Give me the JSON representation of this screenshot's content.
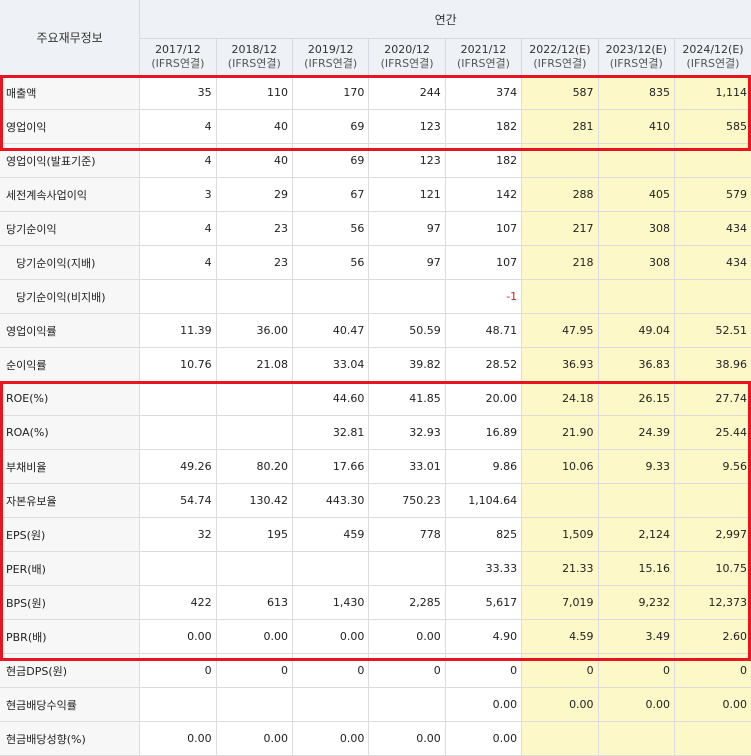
{
  "table": {
    "row_header": "주요재무정보",
    "group_header": "연간",
    "columns": [
      {
        "year": "2017/12",
        "basis": "(IFRS연결)",
        "estimate": false
      },
      {
        "year": "2018/12",
        "basis": "(IFRS연결)",
        "estimate": false
      },
      {
        "year": "2019/12",
        "basis": "(IFRS연결)",
        "estimate": false
      },
      {
        "year": "2020/12",
        "basis": "(IFRS연결)",
        "estimate": false
      },
      {
        "year": "2021/12",
        "basis": "(IFRS연결)",
        "estimate": false
      },
      {
        "year": "2022/12(E)",
        "basis": "(IFRS연결)",
        "estimate": true
      },
      {
        "year": "2023/12(E)",
        "basis": "(IFRS연결)",
        "estimate": true
      },
      {
        "year": "2024/12(E)",
        "basis": "(IFRS연결)",
        "estimate": true
      }
    ],
    "rows": [
      {
        "label": "매출액",
        "indent": false,
        "values": [
          "35",
          "110",
          "170",
          "244",
          "374",
          "587",
          "835",
          "1,114"
        ]
      },
      {
        "label": "영업이익",
        "indent": false,
        "values": [
          "4",
          "40",
          "69",
          "123",
          "182",
          "281",
          "410",
          "585"
        ]
      },
      {
        "label": "영업이익(발표기준)",
        "indent": false,
        "values": [
          "4",
          "40",
          "69",
          "123",
          "182",
          "",
          "",
          ""
        ]
      },
      {
        "label": "세전계속사업이익",
        "indent": false,
        "values": [
          "3",
          "29",
          "67",
          "121",
          "142",
          "288",
          "405",
          "579"
        ]
      },
      {
        "label": "당기순이익",
        "indent": false,
        "values": [
          "4",
          "23",
          "56",
          "97",
          "107",
          "217",
          "308",
          "434"
        ]
      },
      {
        "label": "당기순이익(지배)",
        "indent": true,
        "values": [
          "4",
          "23",
          "56",
          "97",
          "107",
          "218",
          "308",
          "434"
        ]
      },
      {
        "label": "당기순이익(비지배)",
        "indent": true,
        "values": [
          "",
          "",
          "",
          "",
          "-1",
          "",
          "",
          ""
        ]
      },
      {
        "label": "영업이익률",
        "indent": false,
        "values": [
          "11.39",
          "36.00",
          "40.47",
          "50.59",
          "48.71",
          "47.95",
          "49.04",
          "52.51"
        ]
      },
      {
        "label": "순이익률",
        "indent": false,
        "values": [
          "10.76",
          "21.08",
          "33.04",
          "39.82",
          "28.52",
          "36.93",
          "36.83",
          "38.96"
        ]
      },
      {
        "label": "ROE(%)",
        "indent": false,
        "values": [
          "",
          "",
          "44.60",
          "41.85",
          "20.00",
          "24.18",
          "26.15",
          "27.74"
        ]
      },
      {
        "label": "ROA(%)",
        "indent": false,
        "values": [
          "",
          "",
          "32.81",
          "32.93",
          "16.89",
          "21.90",
          "24.39",
          "25.44"
        ]
      },
      {
        "label": "부채비율",
        "indent": false,
        "values": [
          "49.26",
          "80.20",
          "17.66",
          "33.01",
          "9.86",
          "10.06",
          "9.33",
          "9.56"
        ]
      },
      {
        "label": "자본유보율",
        "indent": false,
        "values": [
          "54.74",
          "130.42",
          "443.30",
          "750.23",
          "1,104.64",
          "",
          "",
          ""
        ]
      },
      {
        "label": "EPS(원)",
        "indent": false,
        "values": [
          "32",
          "195",
          "459",
          "778",
          "825",
          "1,509",
          "2,124",
          "2,997"
        ]
      },
      {
        "label": "PER(배)",
        "indent": false,
        "values": [
          "",
          "",
          "",
          "",
          "33.33",
          "21.33",
          "15.16",
          "10.75"
        ]
      },
      {
        "label": "BPS(원)",
        "indent": false,
        "values": [
          "422",
          "613",
          "1,430",
          "2,285",
          "5,617",
          "7,019",
          "9,232",
          "12,373"
        ]
      },
      {
        "label": "PBR(배)",
        "indent": false,
        "values": [
          "0.00",
          "0.00",
          "0.00",
          "0.00",
          "4.90",
          "4.59",
          "3.49",
          "2.60"
        ]
      },
      {
        "label": "현금DPS(원)",
        "indent": false,
        "values": [
          "0",
          "0",
          "0",
          "0",
          "0",
          "0",
          "0",
          "0"
        ]
      },
      {
        "label": "현금배당수익률",
        "indent": false,
        "values": [
          "",
          "",
          "",
          "",
          "0.00",
          "0.00",
          "0.00",
          "0.00"
        ]
      },
      {
        "label": "현금배당성향(%)",
        "indent": false,
        "values": [
          "0.00",
          "0.00",
          "0.00",
          "0.00",
          "0.00",
          "",
          "",
          ""
        ]
      }
    ]
  },
  "colors": {
    "header_bg": "#eef2f6",
    "estimate_bg": "#fdf8c8",
    "highlight_box": "#e8141f",
    "negative": "#d42020"
  }
}
